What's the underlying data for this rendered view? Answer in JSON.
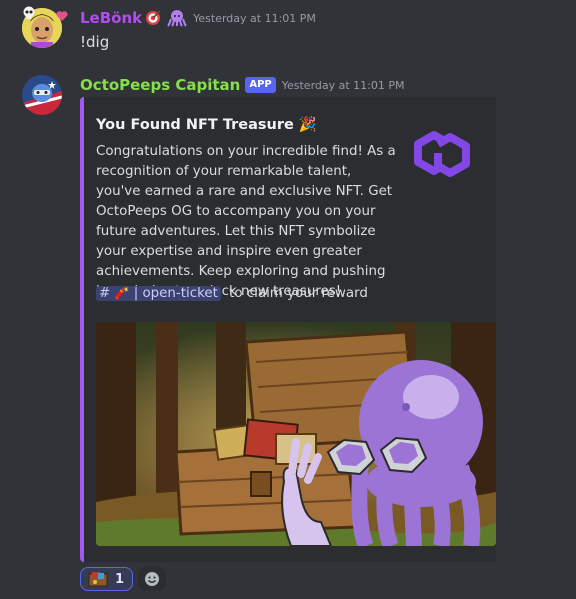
{
  "colors": {
    "background": "#313338",
    "embed_bg": "#2b2d31",
    "embed_accent": "#a259f2",
    "user1_name": "#b14cf2",
    "user2_name": "#85e04a",
    "app_badge": "#5865f2"
  },
  "message1": {
    "username": "LeBönk",
    "username_icons": [
      "target-icon",
      "octopus-icon"
    ],
    "timestamp": "Yesterday at 11:01 PM",
    "text": "!dig"
  },
  "message2": {
    "username": "OctoPeeps Capitan",
    "badge": "APP",
    "timestamp": "Yesterday at 11:01 PM",
    "embed": {
      "title": "You Found NFT Treasure 🎉",
      "description": "Congratulations on your incredible find! As a recognition of your remarkable talent, you've earned a rare and exclusive NFT. Get OctoPeeps OG to accompany you on your future adventures. Let this NFT symbolize your expertise and inspire even greater achievements. Keep exploring and pushing boundaries to unlock new treasures!",
      "channel_hash": "#",
      "channel_emoji": "🧨",
      "channel_name": "| open-ticket",
      "channel_suffix": " to claim your reward",
      "thumbnail": "polygon-logo-icon",
      "image": "octopus-treasure-chest-illustration"
    },
    "reactions": [
      {
        "emoji": "treasure-chest-icon",
        "count": "1"
      }
    ],
    "add_reaction_icon": "add-reaction-icon"
  }
}
